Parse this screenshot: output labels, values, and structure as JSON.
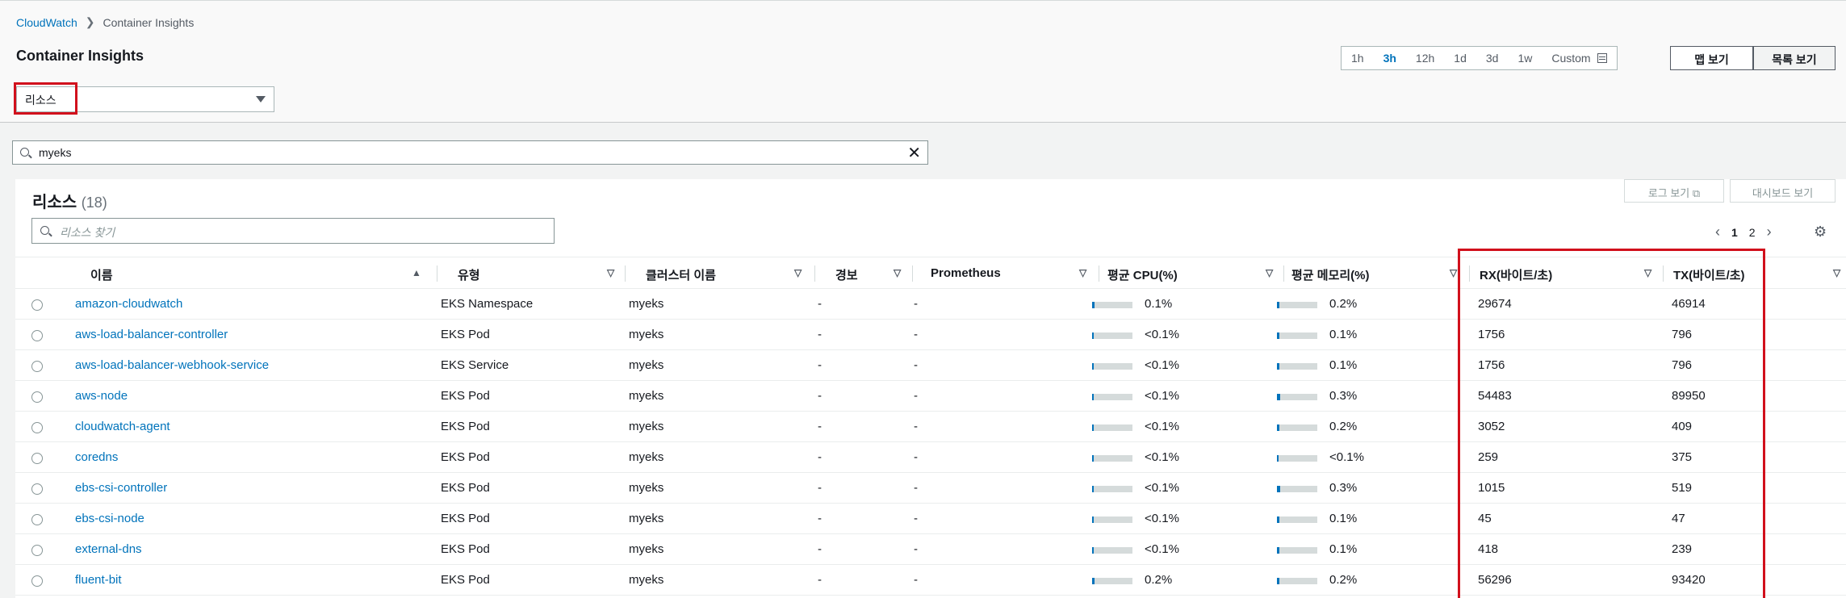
{
  "breadcrumb": {
    "root": "CloudWatch",
    "current": "Container Insights"
  },
  "page_title": "Container Insights",
  "resource_dropdown": {
    "value": "리소스"
  },
  "time_range": {
    "options": [
      "1h",
      "3h",
      "12h",
      "1d",
      "3d",
      "1w",
      "Custom"
    ],
    "selected": "3h"
  },
  "view_buttons": {
    "map": "맵 보기",
    "list": "목록 보기"
  },
  "filter_search": {
    "value": "myeks"
  },
  "panel": {
    "title": "리소스",
    "count": "(18)",
    "log_button": "로그 보기",
    "dashboard_button": "대시보드 보기",
    "search_placeholder": "리소스 찾기",
    "pages": [
      "1",
      "2"
    ],
    "current_page": "1"
  },
  "columns": [
    "이름",
    "유형",
    "클러스터 이름",
    "경보",
    "Prometheus",
    "평균 CPU(%)",
    "평균 메모리(%)",
    "RX(바이트/초)",
    "TX(바이트/초)"
  ],
  "rows": [
    {
      "name": "amazon-cloudwatch",
      "type": "EKS Namespace",
      "cluster": "myeks",
      "alarm": "-",
      "prometheus": "-",
      "cpu": "0.1%",
      "cpu_fill": 0.06,
      "mem": "0.2%",
      "mem_fill": 0.06,
      "rx": "29674",
      "tx": "46914"
    },
    {
      "name": "aws-load-balancer-controller",
      "type": "EKS Pod",
      "cluster": "myeks",
      "alarm": "-",
      "prometheus": "-",
      "cpu": "<0.1%",
      "cpu_fill": 0.04,
      "mem": "0.1%",
      "mem_fill": 0.05,
      "rx": "1756",
      "tx": "796"
    },
    {
      "name": "aws-load-balancer-webhook-service",
      "type": "EKS Service",
      "cluster": "myeks",
      "alarm": "-",
      "prometheus": "-",
      "cpu": "<0.1%",
      "cpu_fill": 0.04,
      "mem": "0.1%",
      "mem_fill": 0.05,
      "rx": "1756",
      "tx": "796"
    },
    {
      "name": "aws-node",
      "type": "EKS Pod",
      "cluster": "myeks",
      "alarm": "-",
      "prometheus": "-",
      "cpu": "<0.1%",
      "cpu_fill": 0.04,
      "mem": "0.3%",
      "mem_fill": 0.07,
      "rx": "54483",
      "tx": "89950"
    },
    {
      "name": "cloudwatch-agent",
      "type": "EKS Pod",
      "cluster": "myeks",
      "alarm": "-",
      "prometheus": "-",
      "cpu": "<0.1%",
      "cpu_fill": 0.04,
      "mem": "0.2%",
      "mem_fill": 0.06,
      "rx": "3052",
      "tx": "409"
    },
    {
      "name": "coredns",
      "type": "EKS Pod",
      "cluster": "myeks",
      "alarm": "-",
      "prometheus": "-",
      "cpu": "<0.1%",
      "cpu_fill": 0.04,
      "mem": "<0.1%",
      "mem_fill": 0.04,
      "rx": "259",
      "tx": "375"
    },
    {
      "name": "ebs-csi-controller",
      "type": "EKS Pod",
      "cluster": "myeks",
      "alarm": "-",
      "prometheus": "-",
      "cpu": "<0.1%",
      "cpu_fill": 0.04,
      "mem": "0.3%",
      "mem_fill": 0.07,
      "rx": "1015",
      "tx": "519"
    },
    {
      "name": "ebs-csi-node",
      "type": "EKS Pod",
      "cluster": "myeks",
      "alarm": "-",
      "prometheus": "-",
      "cpu": "<0.1%",
      "cpu_fill": 0.04,
      "mem": "0.1%",
      "mem_fill": 0.05,
      "rx": "45",
      "tx": "47"
    },
    {
      "name": "external-dns",
      "type": "EKS Pod",
      "cluster": "myeks",
      "alarm": "-",
      "prometheus": "-",
      "cpu": "<0.1%",
      "cpu_fill": 0.04,
      "mem": "0.1%",
      "mem_fill": 0.05,
      "rx": "418",
      "tx": "239"
    },
    {
      "name": "fluent-bit",
      "type": "EKS Pod",
      "cluster": "myeks",
      "alarm": "-",
      "prometheus": "-",
      "cpu": "0.2%",
      "cpu_fill": 0.06,
      "mem": "0.2%",
      "mem_fill": 0.06,
      "rx": "56296",
      "tx": "93420"
    }
  ]
}
